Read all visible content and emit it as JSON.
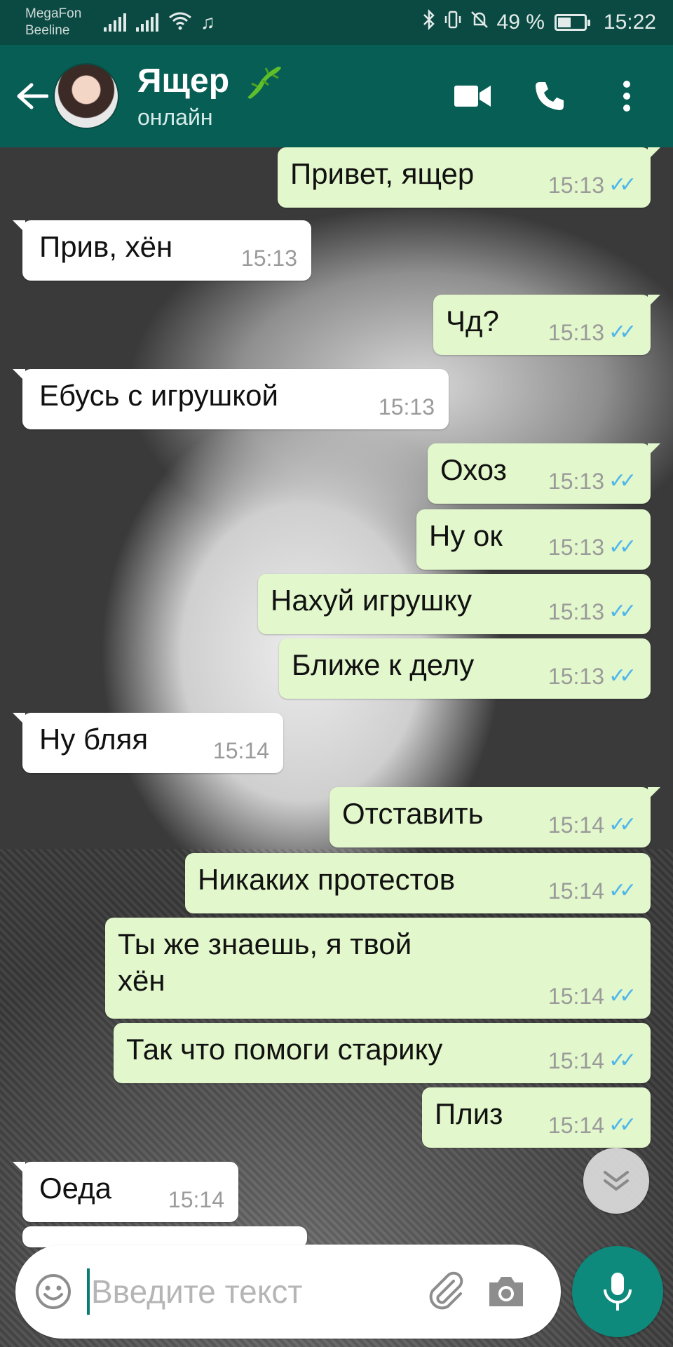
{
  "status_bar": {
    "carrier_1": "MegaFon",
    "carrier_2": "Beeline",
    "battery_text": "49 %",
    "battery_level": 0.49,
    "time": "15:22"
  },
  "header": {
    "contact_name": "Ящер",
    "contact_status": "онлайн"
  },
  "messages": [
    {
      "dir": "out",
      "text": "Привет, ящер",
      "time": "15:13"
    },
    {
      "dir": "in",
      "text": "Прив, хён",
      "time": "15:13"
    },
    {
      "dir": "out",
      "text": "Чд?",
      "time": "15:13"
    },
    {
      "dir": "in",
      "text": "Ебусь с игрушкой",
      "time": "15:13"
    },
    {
      "dir": "out",
      "text": "Охоз",
      "time": "15:13"
    },
    {
      "dir": "out",
      "text": "Ну ок",
      "time": "15:13"
    },
    {
      "dir": "out",
      "text": "Нахуй игрушку",
      "time": "15:13"
    },
    {
      "dir": "out",
      "text": "Ближе к делу",
      "time": "15:13"
    },
    {
      "dir": "in",
      "text": "Ну бляя",
      "time": "15:14"
    },
    {
      "dir": "out",
      "text": "Отставить",
      "time": "15:14"
    },
    {
      "dir": "out",
      "text": "Никаких протестов",
      "time": "15:14"
    },
    {
      "dir": "out",
      "text": "Ты же знаешь, я твой\nхён",
      "time": "15:14"
    },
    {
      "dir": "out",
      "text": "Так что помоги старику",
      "time": "15:14"
    },
    {
      "dir": "out",
      "text": "Плиз",
      "time": "15:14"
    },
    {
      "dir": "in",
      "text": "Оеда",
      "time": "15:14"
    }
  ],
  "input": {
    "placeholder": "Введите текст",
    "value": ""
  },
  "icons": {
    "back": "arrow-left-icon",
    "video": "video-call-icon",
    "call": "phone-icon",
    "menu": "more-vert-icon",
    "emoji": "emoji-icon",
    "attach": "paperclip-icon",
    "camera": "camera-icon",
    "mic": "microphone-icon",
    "scroll": "chevron-double-down-icon",
    "lizard": "lizard-emoji"
  },
  "colors": {
    "header": "#075e54",
    "status_bar": "#0b4a42",
    "bubble_out": "#e2f7cb",
    "bubble_in": "#ffffff",
    "read_ticks": "#4fb6ec",
    "mic_button": "#0e8a7c"
  }
}
